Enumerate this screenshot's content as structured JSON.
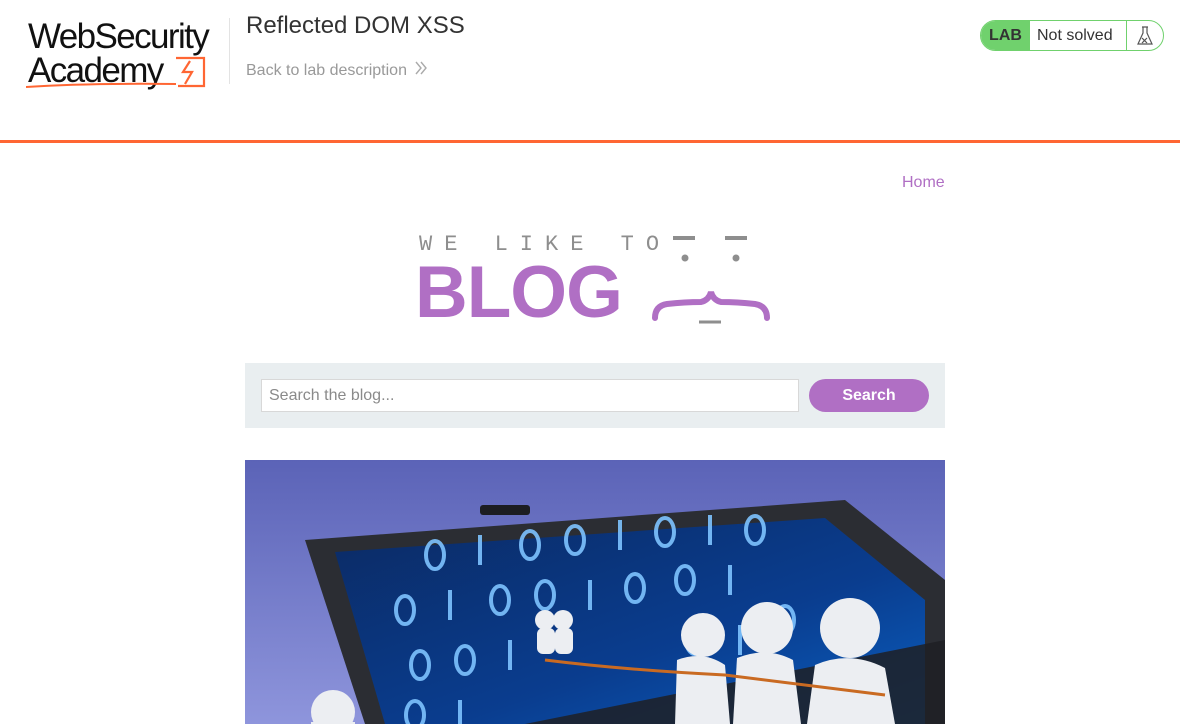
{
  "academy": {
    "logo_line1": "WebSecurity",
    "logo_line2": "Academy",
    "lab_title": "Reflected DOM XSS",
    "back_link": "Back to lab description",
    "lab_badge": "LAB",
    "lab_status": "Not solved",
    "icons": {
      "back": "double-chevron-right-icon",
      "status": "flask-icon"
    },
    "colors": {
      "accent": "#ff6633",
      "status_green": "#70d16d"
    }
  },
  "blog": {
    "nav": {
      "home": "Home"
    },
    "logo": {
      "tagline": "WE LIKE TO",
      "word": "BLOG"
    },
    "search": {
      "placeholder": "Search the blog...",
      "button": "Search"
    },
    "colors": {
      "brand": "#b06fc4",
      "panel": "#e9eef0"
    }
  }
}
